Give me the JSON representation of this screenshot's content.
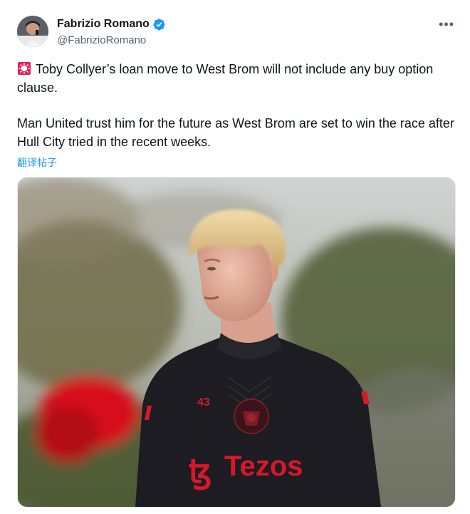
{
  "author": {
    "name": "Fabrizio Romano",
    "handle": "@FabrizioRomano",
    "verified_color": "#1d9bf0",
    "avatar_icon": "profile-photo"
  },
  "menu": {
    "more_label": "•••"
  },
  "tweet": {
    "line1": "Toby Collyer’s loan move to West Brom will not include any buy option clause.",
    "line2": "Man United trust him for the future as West Brom are set to win the race after Hull City tried in the recent weeks.",
    "emoji": "siren-icon",
    "translate_label": "翻译帖子"
  },
  "media": {
    "jersey_number": "43",
    "sponsor": "Tezos",
    "sponsor_logo": "ꜩ",
    "jersey_color": "#1c1c22",
    "accent_color": "#d7182a"
  },
  "colors": {
    "link": "#1d9bf0",
    "secondary_text": "#536471",
    "primary_text": "#0f1419"
  }
}
